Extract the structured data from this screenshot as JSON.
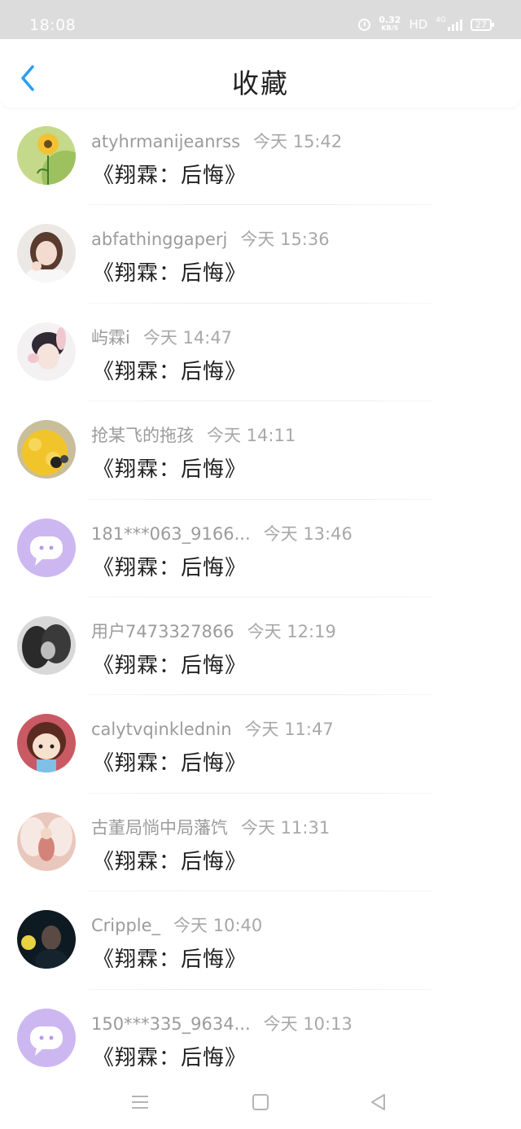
{
  "status_bar": {
    "time": "18:08",
    "net_speed_value": "0.32",
    "net_speed_unit": "KB/S",
    "hd": "HD",
    "network": "4G",
    "battery": "27"
  },
  "header": {
    "title": "收藏",
    "back_icon": "chevron-left-icon",
    "accent_color": "#2a9df4"
  },
  "items": [
    {
      "username": "atyhrmanijeanrss",
      "time": "今天 15:42",
      "title": "《翔霖：后悔》",
      "avatar": "flower"
    },
    {
      "username": "abfathinggaperj",
      "time": "今天 15:36",
      "title": "《翔霖：后悔》",
      "avatar": "girl"
    },
    {
      "username": "屿霖i",
      "time": "今天 14:47",
      "title": "《翔霖：后悔》",
      "avatar": "boy-bunny"
    },
    {
      "username": "抢某飞的拖孩",
      "time": "今天 14:11",
      "title": "《翔霖：后悔》",
      "avatar": "yellow"
    },
    {
      "username": "181***063_9166...",
      "time": "今天 13:46",
      "title": "《翔霖：后悔》",
      "avatar": "default-chat"
    },
    {
      "username": "用户7473327866",
      "time": "今天 12:19",
      "title": "《翔霖：后悔》",
      "avatar": "couple"
    },
    {
      "username": "calytvqinklednin",
      "time": "今天 11:47",
      "title": "《翔霖：后悔》",
      "avatar": "cartoon"
    },
    {
      "username": "古董局惝中局藩饩",
      "time": "今天 11:31",
      "title": "《翔霖：后悔》",
      "avatar": "angel"
    },
    {
      "username": "Cripple_",
      "time": "今天 10:40",
      "title": "《翔霖：后悔》",
      "avatar": "dark"
    },
    {
      "username": "150***335_9634...",
      "time": "今天 10:13",
      "title": "《翔霖：后悔》",
      "avatar": "default-chat"
    }
  ],
  "nav_bar": {
    "menu_icon": "menu-icon",
    "home_icon": "home-square-icon",
    "back_icon": "back-triangle-icon"
  }
}
